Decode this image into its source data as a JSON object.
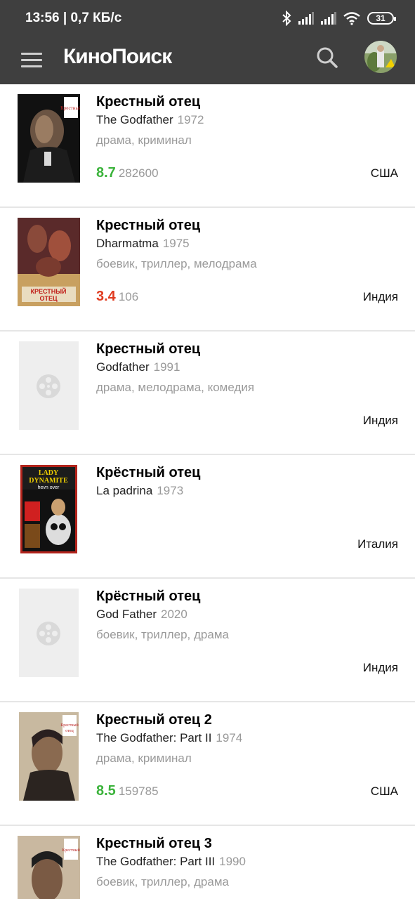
{
  "status_bar": {
    "time": "13:56 | 0,7 КБ/с",
    "battery": "31"
  },
  "app_bar": {
    "logo": "КиноПоиск"
  },
  "films": [
    {
      "title": "Крестный отец",
      "original_title": "The Godfather",
      "year": "1972",
      "genres": "драма, криминал",
      "rating": "8.7",
      "votes": "282600",
      "country": "США",
      "poster": "godfather"
    },
    {
      "title": "Крестный отец",
      "original_title": "Dharmatma",
      "year": "1975",
      "genres": "боевик, триллер, мелодрама",
      "rating": "3.4",
      "votes": "106",
      "country": "Индия",
      "poster": "dharmatma"
    },
    {
      "title": "Крестный отец",
      "original_title": "Godfather",
      "year": "1991",
      "genres": "драма, мелодрама, комедия",
      "rating": "",
      "votes": "",
      "country": "Индия",
      "poster": "placeholder"
    },
    {
      "title": "Крёстный отец",
      "original_title": "La padrina",
      "year": "1973",
      "genres": "",
      "rating": "",
      "votes": "",
      "country": "Италия",
      "poster": "ladydynamite"
    },
    {
      "title": "Крёстный отец",
      "original_title": "God Father",
      "year": "2020",
      "genres": "боевик, триллер, драма",
      "rating": "",
      "votes": "",
      "country": "Индия",
      "poster": "placeholder"
    },
    {
      "title": "Крестный отец 2",
      "original_title": "The Godfather: Part II",
      "year": "1974",
      "genres": "драма, криминал",
      "rating": "8.5",
      "votes": "159785",
      "country": "США",
      "poster": "godfather2"
    },
    {
      "title": "Крестный отец 3",
      "original_title": "The Godfather: Part III",
      "year": "1990",
      "genres": "боевик, триллер, драма",
      "rating": "",
      "votes": "",
      "country": "",
      "poster": "godfather3"
    }
  ],
  "colors": {
    "bar_bg": "#3f3f3f",
    "rating_good": "#3bb33b",
    "rating_bad": "#e03b20",
    "divider": "#e6e6e6"
  }
}
